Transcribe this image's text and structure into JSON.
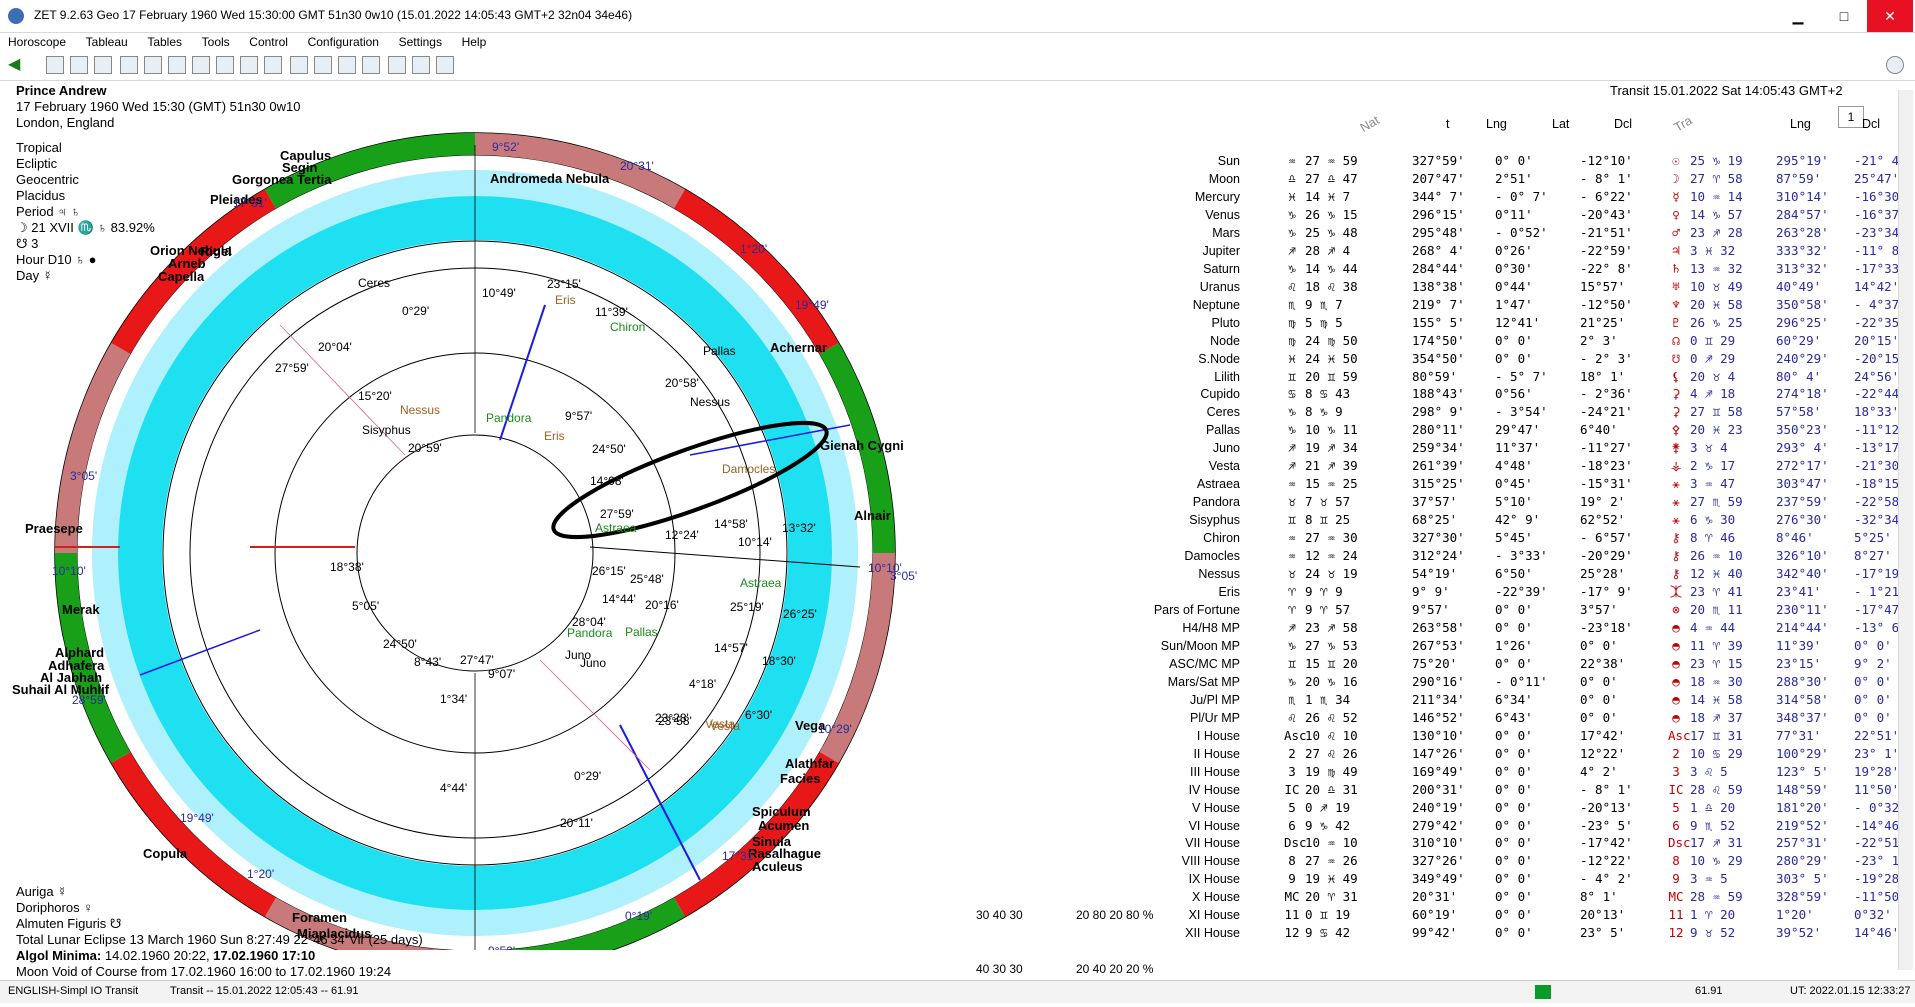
{
  "window": {
    "title": "ZET 9.2.63 Geo   17 February 1960  Wed  15:30:00 GMT 51n30  0w10  (15.01.2022  14:05:43 GMT+2 32n04 34e46)",
    "minimize": "▁",
    "maximize": "□",
    "close": "✕"
  },
  "menu": [
    "Horoscope",
    "Tableau",
    "Tables",
    "Tools",
    "Control",
    "Configuration",
    "Settings",
    "Help"
  ],
  "toolbar": {
    "combo_value": "1"
  },
  "chart_info": {
    "name": "Prince Andrew",
    "line1": "17 February 1960   Wed   15:30 (GMT) 51n30   0w10",
    "line2": "London, England"
  },
  "settings": {
    "items": [
      "Tropical",
      "Ecliptic",
      "Geocentric",
      "Placidus",
      "Period  ♃ ♄",
      "☽   21 XVII ♏ ♄ 83.92%",
      "☋   3",
      "Hour D10  ♄  ●",
      "Day  ☿"
    ]
  },
  "transit_header": "Transit 15.01.2022   Sat 14:05:43 GMT+2",
  "table_headers": {
    "nat": "Nat",
    "t": "t",
    "lng": "Lng",
    "lat": "Lat",
    "dcl": "Dcl",
    "tra": "Tra",
    "tlng": "Lng",
    "tdcl": "Dcl"
  },
  "planets": [
    {
      "name": "Sun",
      "sign": "♒",
      "deg": "27 ♒ 59",
      "lng": "327°59'",
      "lat": "0° 0'",
      "dcl": "-12°10'",
      "tsign": "☉",
      "tdeg": "25 ♑ 19",
      "tlng": "295°19'",
      "tdcl": "-21° 4'"
    },
    {
      "name": "Moon",
      "sign": "♎",
      "deg": "27 ♎ 47",
      "lng": "207°47'",
      "lat": "2°51'",
      "dcl": "- 8° 1'",
      "tsign": "☽",
      "tdeg": "27 ♈ 58",
      "tlng": "87°59'",
      "tdcl": "25°47'"
    },
    {
      "name": "Mercury",
      "sign": "♓",
      "deg": "14 ♓ 7",
      "lng": "344° 7'",
      "lat": "- 0° 7'",
      "dcl": "- 6°22'",
      "tsign": "☿",
      "tdeg": "10 ♒ 14",
      "tlng": "310°14'",
      "tdcl": "-16°30'"
    },
    {
      "name": "Venus",
      "sign": "♑",
      "deg": "26 ♑ 15",
      "lng": "296°15'",
      "lat": "0°11'",
      "dcl": "-20°43'",
      "tsign": "♀",
      "tdeg": "14 ♑ 57",
      "tlng": "284°57'",
      "tdcl": "-16°37'"
    },
    {
      "name": "Mars",
      "sign": "♑",
      "deg": "25 ♑ 48",
      "lng": "295°48'",
      "lat": "- 0°52'",
      "dcl": "-21°51'",
      "tsign": "♂",
      "tdeg": "23 ♐ 28",
      "tlng": "263°28'",
      "tdcl": "-23°34'"
    },
    {
      "name": "Jupiter",
      "sign": "♐",
      "deg": "28 ♐ 4",
      "lng": "268° 4'",
      "lat": "0°26'",
      "dcl": "-22°59'",
      "tsign": "♃",
      "tdeg": "3 ♓ 32",
      "tlng": "333°32'",
      "tdcl": "-11° 8'"
    },
    {
      "name": "Saturn",
      "sign": "♑",
      "deg": "14 ♑ 44",
      "lng": "284°44'",
      "lat": "0°30'",
      "dcl": "-22° 8'",
      "tsign": "♄",
      "tdeg": "13 ♒ 32",
      "tlng": "313°32'",
      "tdcl": "-17°33'"
    },
    {
      "name": "Uranus",
      "sign": "♌",
      "deg": "18 ♌ 38",
      "lng": "138°38'",
      "lat": "0°44'",
      "dcl": "15°57'",
      "tsign": "♅",
      "tdeg": "10 ♉ 49",
      "tlng": "40°49'",
      "tdcl": "14°42'"
    },
    {
      "name": "Neptune",
      "sign": "♏",
      "deg": "9 ♏ 7",
      "lng": "219° 7'",
      "lat": "1°47'",
      "dcl": "-12°50'",
      "tsign": "♆",
      "tdeg": "20 ♓ 58",
      "tlng": "350°58'",
      "tdcl": "- 4°37'"
    },
    {
      "name": "Pluto",
      "sign": "♍",
      "deg": "5 ♍ 5",
      "lng": "155° 5'",
      "lat": "12°41'",
      "dcl": "21°25'",
      "tsign": "♇",
      "tdeg": "26 ♑ 25",
      "tlng": "296°25'",
      "tdcl": "-22°35'"
    },
    {
      "name": "Node",
      "sign": "♍",
      "deg": "24 ♍ 50",
      "lng": "174°50'",
      "lat": "0° 0'",
      "dcl": "2° 3'",
      "tsign": "☊",
      "tdeg": "0 ♊ 29",
      "tlng": "60°29'",
      "tdcl": "20°15'"
    },
    {
      "name": "S.Node",
      "sign": "♓",
      "deg": "24 ♓ 50",
      "lng": "354°50'",
      "lat": "0° 0'",
      "dcl": "- 2° 3'",
      "tsign": "☋",
      "tdeg": "0 ♐ 29",
      "tlng": "240°29'",
      "tdcl": "-20°15'"
    },
    {
      "name": "Lilith",
      "sign": "♊",
      "deg": "20 ♊ 59",
      "lng": "80°59'",
      "lat": "- 5° 7'",
      "dcl": "18° 1'",
      "tsign": "⚸",
      "tdeg": "20 ♉ 4",
      "tlng": "80° 4'",
      "tdcl": "24°56'"
    },
    {
      "name": "Cupido",
      "sign": "♋",
      "deg": "8 ♋ 43",
      "lng": "188°43'",
      "lat": "0°56'",
      "dcl": "- 2°36'",
      "tsign": "⚳",
      "tdeg": "4 ♐ 18",
      "tlng": "274°18'",
      "tdcl": "-22°44'"
    },
    {
      "name": "Ceres",
      "sign": "♑",
      "deg": "8 ♑ 9",
      "lng": "298° 9'",
      "lat": "- 3°54'",
      "dcl": "-24°21'",
      "tsign": "⚳",
      "tdeg": "27 ♊ 58",
      "tlng": "57°58'",
      "tdcl": "18°33'"
    },
    {
      "name": "Pallas",
      "sign": "♑",
      "deg": "10 ♑ 11",
      "lng": "280°11'",
      "lat": "29°47'",
      "dcl": "6°40'",
      "tsign": "⚴",
      "tdeg": "20 ♓ 23",
      "tlng": "350°23'",
      "tdcl": "-11°12'"
    },
    {
      "name": "Juno",
      "sign": "♐",
      "deg": "19 ♐ 34",
      "lng": "259°34'",
      "lat": "11°37'",
      "dcl": "-11°27'",
      "tsign": "⚵",
      "tdeg": "3 ♉ 4",
      "tlng": "293° 4'",
      "tdcl": "-13°17'"
    },
    {
      "name": "Vesta",
      "sign": "♐",
      "deg": "21 ♐ 39",
      "lng": "261°39'",
      "lat": "4°48'",
      "dcl": "-18°23'",
      "tsign": "⚶",
      "tdeg": "2 ♑ 17",
      "tlng": "272°17'",
      "tdcl": "-21°30'"
    },
    {
      "name": "Astraea",
      "sign": "♒",
      "deg": "15 ♒ 25",
      "lng": "315°25'",
      "lat": "0°45'",
      "dcl": "-15°31'",
      "tsign": "⚹",
      "tdeg": "3 ♒ 47",
      "tlng": "303°47'",
      "tdcl": "-18°15'"
    },
    {
      "name": "Pandora",
      "sign": "♉",
      "deg": "7 ♉ 57",
      "lng": "37°57'",
      "lat": "5°10'",
      "dcl": "19° 2'",
      "tsign": "⚹",
      "tdeg": "27 ♏ 59",
      "tlng": "237°59'",
      "tdcl": "-22°58'"
    },
    {
      "name": "Sisyphus",
      "sign": "♊",
      "deg": "8 ♊ 25",
      "lng": "68°25'",
      "lat": "42° 9'",
      "dcl": "62°52'",
      "tsign": "⚹",
      "tdeg": "6 ♑ 30",
      "tlng": "276°30'",
      "tdcl": "-32°34'"
    },
    {
      "name": "Chiron",
      "sign": "♒",
      "deg": "27 ♒ 30",
      "lng": "327°30'",
      "lat": "5°45'",
      "dcl": "- 6°57'",
      "tsign": "⚷",
      "tdeg": "8 ♈ 46",
      "tlng": "8°46'",
      "tdcl": "5°25'"
    },
    {
      "name": "Damocles",
      "sign": "♒",
      "deg": "12 ♒ 24",
      "lng": "312°24'",
      "lat": "- 3°33'",
      "dcl": "-20°29'",
      "tsign": "⚷",
      "tdeg": "26 ♒ 10",
      "tlng": "326°10'",
      "tdcl": "8°27'"
    },
    {
      "name": "Nessus",
      "sign": "♉",
      "deg": "24 ♉ 19",
      "lng": "54°19'",
      "lat": "6°50'",
      "dcl": "25°28'",
      "tsign": "⚷",
      "tdeg": "12 ♓ 40",
      "tlng": "342°40'",
      "tdcl": "-17°19'"
    },
    {
      "name": "Eris",
      "sign": "♈",
      "deg": "9 ♈ 9",
      "lng": "9° 9'",
      "lat": "-22°39'",
      "dcl": "-17° 9'",
      "tsign": "⯰",
      "tdeg": "23 ♈ 41",
      "tlng": "23°41'",
      "tdcl": "- 1°21'"
    },
    {
      "name": "Pars of Fortune",
      "sign": "♈",
      "deg": "9 ♈ 57",
      "lng": "9°57'",
      "lat": "0° 0'",
      "dcl": "3°57'",
      "tsign": "⊗",
      "tdeg": "20 ♏ 11",
      "tlng": "230°11'",
      "tdcl": "-17°47'"
    },
    {
      "name": "H4/H8 MP",
      "sign": "♐",
      "deg": "23 ♐ 58",
      "lng": "263°58'",
      "lat": "0° 0'",
      "dcl": "-23°18'",
      "tsign": "◓",
      "tdeg": "4 ♒ 44",
      "tlng": "214°44'",
      "tdcl": "-13° 6'"
    },
    {
      "name": "Sun/Moon MP",
      "sign": "♑",
      "deg": "27 ♑ 53",
      "lng": "267°53'",
      "lat": "1°26'",
      "dcl": "0° 0'",
      "tsign": "◓",
      "tdeg": "11 ♈ 39",
      "tlng": "11°39'",
      "tdcl": "0° 0'"
    },
    {
      "name": "ASC/MC MP",
      "sign": "♊",
      "deg": "15 ♊ 20",
      "lng": "75°20'",
      "lat": "0° 0'",
      "dcl": "22°38'",
      "tsign": "◓",
      "tdeg": "23 ♈ 15",
      "tlng": "23°15'",
      "tdcl": "9° 2'"
    },
    {
      "name": "Mars/Sat MP",
      "sign": "♑",
      "deg": "20 ♑ 16",
      "lng": "290°16'",
      "lat": "- 0°11'",
      "dcl": "0° 0'",
      "tsign": "◓",
      "tdeg": "18 ♒ 30",
      "tlng": "288°30'",
      "tdcl": "0° 0'"
    },
    {
      "name": "Ju/Pl MP",
      "sign": "♏",
      "deg": "1 ♏ 34",
      "lng": "211°34'",
      "lat": "6°34'",
      "dcl": "0° 0'",
      "tsign": "◓",
      "tdeg": "14 ♓ 58",
      "tlng": "314°58'",
      "tdcl": "0° 0'"
    },
    {
      "name": "Pl/Ur MP",
      "sign": "♌",
      "deg": "26 ♌ 52",
      "lng": "146°52'",
      "lat": "6°43'",
      "dcl": "0° 0'",
      "tsign": "◓",
      "tdeg": "18 ♐ 37",
      "tlng": "348°37'",
      "tdcl": "0° 0'"
    },
    {
      "name": "I House",
      "sign": "Asc",
      "deg": "10 ♌ 10",
      "lng": "130°10'",
      "lat": "0° 0'",
      "dcl": "17°42'",
      "tsign": "Asc",
      "tdeg": "17 ♊ 31",
      "tlng": "77°31'",
      "tdcl": "22°51'"
    },
    {
      "name": "II House",
      "sign": "2",
      "deg": "27 ♌ 26",
      "lng": "147°26'",
      "lat": "0° 0'",
      "dcl": "12°22'",
      "tsign": "2",
      "tdeg": "10 ♋ 29",
      "tlng": "100°29'",
      "tdcl": "23° 1'"
    },
    {
      "name": "III House",
      "sign": "3",
      "deg": "19 ♍ 49",
      "lng": "169°49'",
      "lat": "0° 0'",
      "dcl": "4° 2'",
      "tsign": "3",
      "tdeg": "3 ♌ 5",
      "tlng": "123° 5'",
      "tdcl": "19°28'"
    },
    {
      "name": "IV House",
      "sign": "IC",
      "deg": "20 ♎ 31",
      "lng": "200°31'",
      "lat": "0° 0'",
      "dcl": "- 8° 1'",
      "tsign": "IC",
      "tdeg": "28 ♌ 59",
      "tlng": "148°59'",
      "tdcl": "11°50'"
    },
    {
      "name": "V House",
      "sign": "5",
      "deg": "0 ♐ 19",
      "lng": "240°19'",
      "lat": "0° 0'",
      "dcl": "-20°13'",
      "tsign": "5",
      "tdeg": "1 ♎ 20",
      "tlng": "181°20'",
      "tdcl": "- 0°32'"
    },
    {
      "name": "VI House",
      "sign": "6",
      "deg": "9 ♑ 42",
      "lng": "279°42'",
      "lat": "0° 0'",
      "dcl": "-23° 5'",
      "tsign": "6",
      "tdeg": "9 ♏ 52",
      "tlng": "219°52'",
      "tdcl": "-14°46'"
    },
    {
      "name": "VII House",
      "sign": "Dsc",
      "deg": "10 ♒ 10",
      "lng": "310°10'",
      "lat": "0° 0'",
      "dcl": "-17°42'",
      "tsign": "Dsc",
      "tdeg": "17 ♐ 31",
      "tlng": "257°31'",
      "tdcl": "-22°51'"
    },
    {
      "name": "VIII House",
      "sign": "8",
      "deg": "27 ♒ 26",
      "lng": "327°26'",
      "lat": "0° 0'",
      "dcl": "-12°22'",
      "tsign": "8",
      "tdeg": "10 ♑ 29",
      "tlng": "280°29'",
      "tdcl": "-23° 1'"
    },
    {
      "name": "IX House",
      "sign": "9",
      "deg": "19 ♓ 49",
      "lng": "349°49'",
      "lat": "0° 0'",
      "dcl": "- 4° 2'",
      "tsign": "9",
      "tdeg": "3 ♒ 5",
      "tlng": "303° 5'",
      "tdcl": "-19°28'"
    },
    {
      "name": "X House",
      "sign": "MC",
      "deg": "20 ♈ 31",
      "lng": "20°31'",
      "lat": "0° 0'",
      "dcl": "8° 1'",
      "tsign": "MC",
      "tdeg": "28 ♒ 59",
      "tlng": "328°59'",
      "tdcl": "-11°50'"
    },
    {
      "name": "XI House",
      "sign": "11",
      "deg": "0 ♊ 19",
      "lng": "60°19'",
      "lat": "0° 0'",
      "dcl": "20°13'",
      "tsign": "11",
      "tdeg": "1 ♈ 20",
      "tlng": "1°20'",
      "tdcl": "0°32'"
    },
    {
      "name": "XII House",
      "sign": "12",
      "deg": "9 ♋ 42",
      "lng": "99°42'",
      "lat": "0° 0'",
      "dcl": "23° 5'",
      "tsign": "12",
      "tdeg": "9 ♉ 52",
      "tlng": "39°52'",
      "tdcl": "14°46'"
    }
  ],
  "wheel": {
    "stars": [
      "Capulus",
      "Segin",
      "Gorgonea Tertia",
      "Pleiades",
      "Andromeda Nebula",
      "Orion Nebula",
      "Rigel",
      "Arneb",
      "Capella",
      "Achernar",
      "Gienah Cygni",
      "Alnair",
      "Praesepe",
      "Merak",
      "Alphard",
      "Adhafera",
      "Al Jabhah",
      "Suhail Al Muhlif",
      "Vega",
      "Alathfar",
      "Facies",
      "Spiculum",
      "Acumen",
      "Sinula",
      "Rasalhague",
      "Aculeus",
      "Copula",
      "Foramen",
      "Miaplacidus"
    ],
    "cusps": [
      "9°52'",
      "20°31'",
      "17°31'",
      "1°20'",
      "19°49'",
      "10°10'",
      "3°05'",
      "28°59'",
      "10°29'",
      "17°31'",
      "0°19'",
      "9°52'",
      "1°20'",
      "19°49'",
      "10°10'",
      "3°05'"
    ],
    "natal_labels": [
      "Ceres",
      "Eris",
      "Chiron",
      "Pallas",
      "Nessus",
      "Pandora",
      "Sisyphus",
      "Damocles",
      "Astraea",
      "Juno",
      "Vesta",
      "Pallas",
      "Nessus",
      "Eris",
      "Pandora",
      "Juno",
      "Vesta",
      "Astraea"
    ],
    "degree_labels": [
      "10°49'",
      "0°29'",
      "23°15'",
      "11°39'",
      "20°04'",
      "27°59'",
      "20°58'",
      "9°57'",
      "24°50'",
      "14°08'",
      "27°59'",
      "13°32'",
      "12°24'",
      "14°58'",
      "10°14'",
      "18°38'",
      "26°15'",
      "25°48'",
      "20°16'",
      "25°19'",
      "14°44'",
      "5°05'",
      "26°25'",
      "28°04'",
      "24°50'",
      "8°43'",
      "27°47'",
      "9°07'",
      "14°57'",
      "18°30'",
      "23°58'",
      "4°18'",
      "1°34'",
      "23°28'",
      "6°30'",
      "0°29'",
      "4°44'",
      "20°11'",
      "15°20'",
      "20°59'"
    ]
  },
  "bottom_info": {
    "line1": "Auriga  ☿",
    "line2": "Doriphoros  ♀",
    "line3": "Almuten Figuris  ☋",
    "line4": "Total Lunar Eclipse 13 March 1960 Sun   8:27:49 22°46'34\"Vir (25 days)",
    "algol_label": "Algol Minima:",
    "algol_value": "14.02.1960 20:22,",
    "algol_value2": "17.02.1960 17:10",
    "line6": "Moon Void of Course from 17.02.1960 16:00 to 17.02.1960 19:24"
  },
  "aspect_legend": {
    "row1": "30   40   30",
    "row2": "20   80   20   80 %",
    "row3": "40   30   30",
    "row4": "20   40   20   20 %"
  },
  "statusbar": {
    "left": "ENGLISH-Simpl  IO Transit",
    "transit": "Transit -- 15.01.2022 12:05:43 -- 61.91",
    "value": "61.91",
    "time": "UT: 2022.01.15 12:33:27"
  }
}
